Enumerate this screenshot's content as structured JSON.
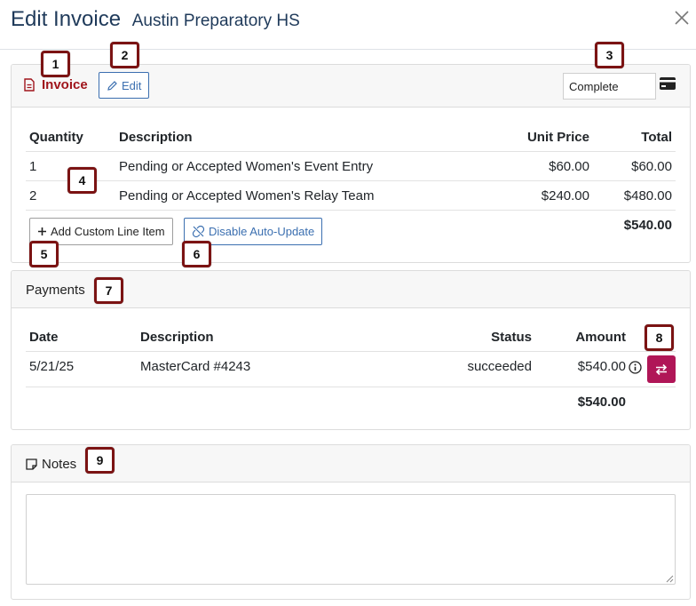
{
  "header": {
    "title": "Edit Invoice",
    "subtitle": "Austin Preparatory HS"
  },
  "invoice": {
    "label": "Invoice",
    "edit_label": "Edit",
    "status_value": "Complete",
    "columns": {
      "quantity": "Quantity",
      "description": "Description",
      "unit_price": "Unit Price",
      "total": "Total"
    },
    "rows": [
      {
        "quantity": "1",
        "description": "Pending or Accepted Women's Event Entry",
        "unit_price": "$60.00",
        "total": "$60.00"
      },
      {
        "quantity": "2",
        "description": "Pending or Accepted Women's Relay Team",
        "unit_price": "$240.00",
        "total": "$480.00"
      }
    ],
    "add_custom_label": "Add Custom Line Item",
    "disable_auto_label": "Disable Auto-Update",
    "grand_total": "$540.00"
  },
  "payments": {
    "label": "Payments",
    "columns": {
      "date": "Date",
      "description": "Description",
      "status": "Status",
      "amount": "Amount"
    },
    "rows": [
      {
        "date": "5/21/25",
        "description": "MasterCard #4243",
        "status": "succeeded",
        "amount": "$540.00"
      }
    ],
    "total": "$540.00"
  },
  "notes": {
    "label": "Notes",
    "value": ""
  },
  "badges": [
    "1",
    "2",
    "3",
    "4",
    "5",
    "6",
    "7",
    "8",
    "9"
  ],
  "colors": {
    "title": "#1f3a5a",
    "invoice_label": "#a0151c",
    "edit_button": "#3b6fb0",
    "refund_button": "#b01657",
    "badge_border": "#7b1313"
  }
}
